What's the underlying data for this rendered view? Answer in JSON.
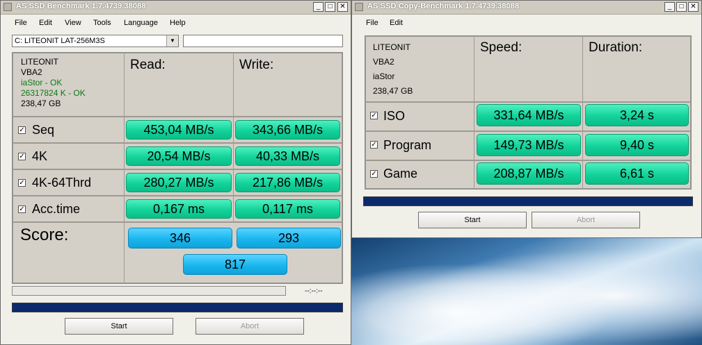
{
  "bench": {
    "title": "AS SSD Benchmark 1.7.4739.38088",
    "menu": [
      "File",
      "Edit",
      "View",
      "Tools",
      "Language",
      "Help"
    ],
    "drive_select": "C: LITEONIT LAT-256M3S",
    "info": [
      "LITEONIT",
      "VBA2",
      "iaStor - OK",
      "26317824 K - OK",
      "238,47 GB"
    ],
    "headers": {
      "read": "Read:",
      "write": "Write:"
    },
    "rows": [
      {
        "label": "Seq",
        "read": "453,04 MB/s",
        "write": "343,66 MB/s"
      },
      {
        "label": "4K",
        "read": "20,54 MB/s",
        "write": "40,33 MB/s"
      },
      {
        "label": "4K-64Thrd",
        "read": "280,27 MB/s",
        "write": "217,86 MB/s"
      },
      {
        "label": "Acc.time",
        "read": "0,167 ms",
        "write": "0,117 ms"
      }
    ],
    "score_label": "Score:",
    "score_read": "346",
    "score_write": "293",
    "score_total": "817",
    "time_display": "--:--:--",
    "progress": 1.0,
    "start_label": "Start",
    "abort_label": "Abort"
  },
  "copy": {
    "title": "AS SSD Copy-Benchmark 1.7.4739.38088",
    "menu": [
      "File",
      "Edit"
    ],
    "info": [
      "LITEONIT",
      "VBA2",
      "iaStor",
      "238,47 GB"
    ],
    "headers": {
      "speed": "Speed:",
      "duration": "Duration:"
    },
    "rows": [
      {
        "label": "ISO",
        "speed": "331,64 MB/s",
        "duration": "3,24 s"
      },
      {
        "label": "Program",
        "speed": "149,73 MB/s",
        "duration": "9,40 s"
      },
      {
        "label": "Game",
        "speed": "208,87 MB/s",
        "duration": "6,61 s"
      }
    ],
    "progress": 1.0,
    "start_label": "Start",
    "abort_label": "Abort"
  },
  "colors": {
    "value_green": "#12d39a",
    "score_blue": "#1ab6ee",
    "progress_navy": "#0c2a6b",
    "ok_green": "#0c7a12"
  }
}
